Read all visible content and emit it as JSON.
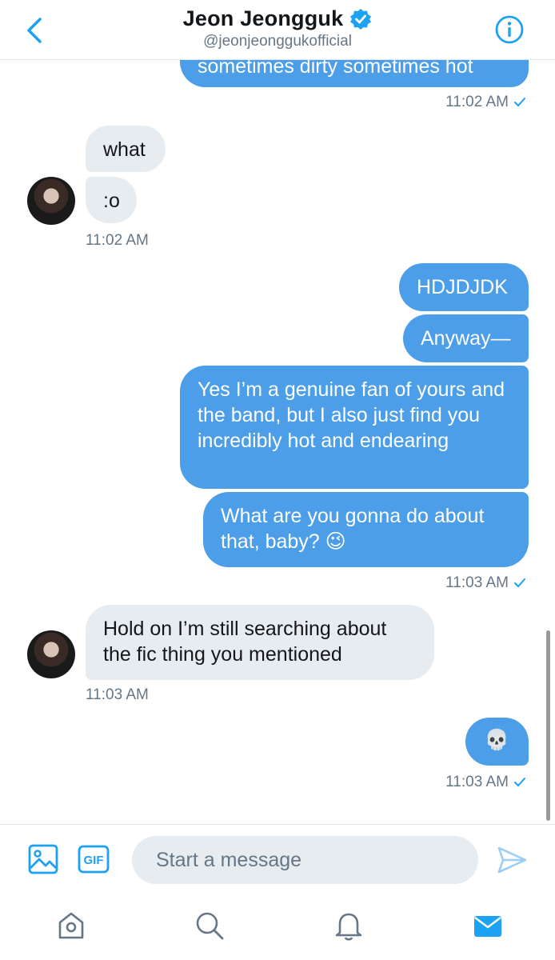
{
  "header": {
    "name": "Jeon Jeongguk",
    "handle": "@jeonjeonggukofficial"
  },
  "messages": [
    {
      "side": "out",
      "text": "sometimes dirty sometimes hot"
    },
    {
      "side": "meta",
      "time": "11:02 AM"
    },
    {
      "side": "in",
      "text": "what"
    },
    {
      "side": "in",
      "text": ":o"
    },
    {
      "side": "meta",
      "time": "11:02 AM"
    },
    {
      "side": "out",
      "text": "HDJDJDK"
    },
    {
      "side": "out",
      "text": "Anyway—"
    },
    {
      "side": "out",
      "text": "Yes I’m a genuine fan of yours and the band, but I also just find you incredibly hot and endearing"
    },
    {
      "side": "out",
      "text": "What are you gonna do about that, baby? 😉"
    },
    {
      "side": "meta",
      "time": "11:03 AM"
    },
    {
      "side": "in",
      "text": "Hold on I’m still searching about the fic thing you mentioned"
    },
    {
      "side": "meta",
      "time": "11:03 AM"
    },
    {
      "side": "out",
      "text": "💀"
    },
    {
      "side": "meta",
      "time": "11:03 AM"
    }
  ],
  "composer": {
    "placeholder": "Start a message",
    "gif_label": "GIF"
  },
  "icons": [
    "back-chevron-icon",
    "verified-badge-icon",
    "info-icon",
    "image-icon",
    "gif-icon",
    "send-icon",
    "home-icon",
    "search-icon",
    "notifications-bell-icon",
    "messages-envelope-icon"
  ],
  "colors": {
    "accent": "#4c9ee8",
    "incoming": "#e6ecf0",
    "meta": "#657786"
  }
}
